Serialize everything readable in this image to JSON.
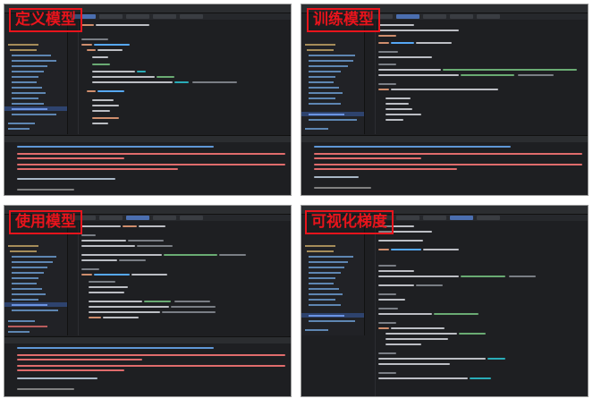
{
  "panels": [
    {
      "label": "定义模型"
    },
    {
      "label": "训练模型"
    },
    {
      "label": "使用模型"
    },
    {
      "label": "可视化梯度"
    }
  ],
  "colors": {
    "label_red": "#e8141c",
    "ide_background": "#1e1f22",
    "active_tab": "#4b6eaf"
  }
}
